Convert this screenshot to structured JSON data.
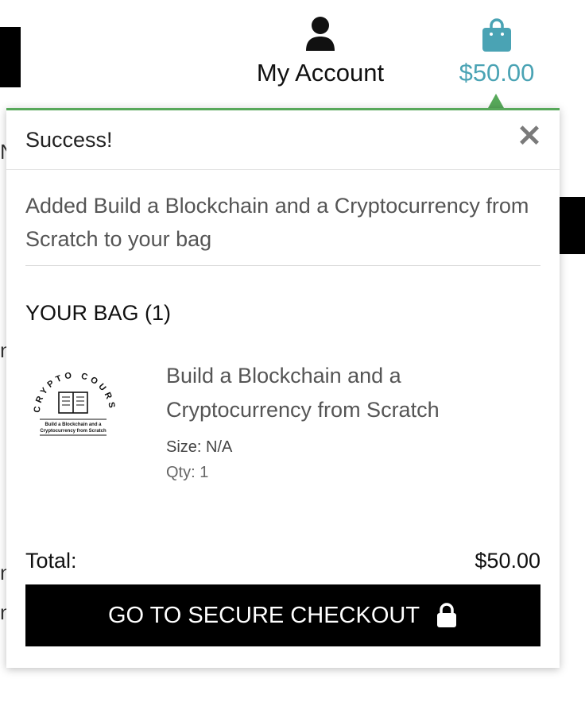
{
  "header": {
    "account_label": "My Account",
    "cart_total": "$50.00"
  },
  "colors": {
    "accent_teal": "#4aa3b4",
    "success_green": "#57a85a",
    "button_black": "#000000"
  },
  "popup": {
    "title": "Success!",
    "close_icon": "close-icon",
    "message": "Added Build a Blockchain and a Cryptocurrency from Scratch to your bag",
    "bag_title": "YOUR BAG (1)",
    "item": {
      "name": "Build a Blockchain and a Cryptocurrency from Scratch",
      "size": "Size: N/A",
      "qty": "Qty: 1",
      "thumb_arc_text": "CRYPTO COURSE",
      "thumb_caption_1": "Build a Blockchain and a",
      "thumb_caption_2": "Cryptocurrency from Scratch"
    },
    "total_label": "Total:",
    "total_value": "$50.00",
    "checkout_label": "GO TO SECURE CHECKOUT"
  }
}
